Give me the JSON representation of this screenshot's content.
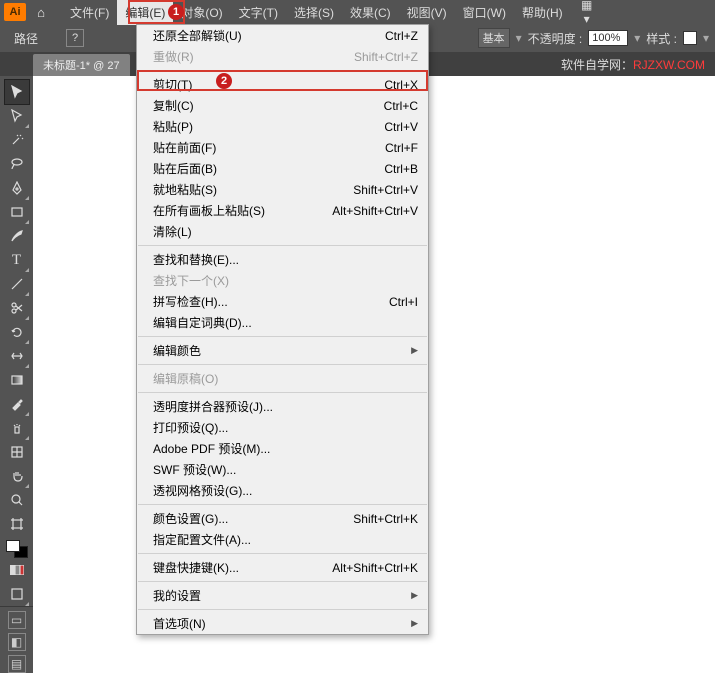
{
  "topbar": {
    "logo": "Ai",
    "menus": [
      "文件(F)",
      "编辑(E)",
      "对象(O)",
      "文字(T)",
      "选择(S)",
      "效果(C)",
      "视图(V)",
      "窗口(W)",
      "帮助(H)"
    ]
  },
  "controlbar": {
    "label": "路径",
    "basic": "基本",
    "opacity_label": "不透明度 :",
    "opacity_value": "100%",
    "style_label": "样式 :"
  },
  "tabbar": {
    "doc": "未标题-1* @ 27",
    "tutorial_lbl": "软件自学网：",
    "tutorial_url": "RJZXW.COM"
  },
  "badges": {
    "b1": "1",
    "b2": "2"
  },
  "dropdown": [
    {
      "label": "还原全部解锁(U)",
      "shortcut": "Ctrl+Z"
    },
    {
      "label": "重做(R)",
      "shortcut": "Shift+Ctrl+Z",
      "disabled": true
    },
    {
      "sep": true
    },
    {
      "label": "剪切(T)",
      "shortcut": "Ctrl+X",
      "highlight": true
    },
    {
      "label": "复制(C)",
      "shortcut": "Ctrl+C"
    },
    {
      "label": "粘贴(P)",
      "shortcut": "Ctrl+V"
    },
    {
      "label": "贴在前面(F)",
      "shortcut": "Ctrl+F"
    },
    {
      "label": "贴在后面(B)",
      "shortcut": "Ctrl+B"
    },
    {
      "label": "就地粘贴(S)",
      "shortcut": "Shift+Ctrl+V"
    },
    {
      "label": "在所有画板上粘贴(S)",
      "shortcut": "Alt+Shift+Ctrl+V"
    },
    {
      "label": "清除(L)"
    },
    {
      "sep": true
    },
    {
      "label": "查找和替换(E)..."
    },
    {
      "label": "查找下一个(X)",
      "disabled": true
    },
    {
      "label": "拼写检查(H)...",
      "shortcut": "Ctrl+I"
    },
    {
      "label": "编辑自定词典(D)..."
    },
    {
      "sep": true
    },
    {
      "label": "编辑颜色",
      "submenu": true
    },
    {
      "sep": true
    },
    {
      "label": "编辑原稿(O)",
      "disabled": true
    },
    {
      "sep": true
    },
    {
      "label": "透明度拼合器预设(J)..."
    },
    {
      "label": "打印预设(Q)..."
    },
    {
      "label": "Adobe PDF 预设(M)..."
    },
    {
      "label": "SWF 预设(W)..."
    },
    {
      "label": "透视网格预设(G)..."
    },
    {
      "sep": true
    },
    {
      "label": "颜色设置(G)...",
      "shortcut": "Shift+Ctrl+K"
    },
    {
      "label": "指定配置文件(A)..."
    },
    {
      "sep": true
    },
    {
      "label": "键盘快捷键(K)...",
      "shortcut": "Alt+Shift+Ctrl+K"
    },
    {
      "sep": true
    },
    {
      "label": "我的设置",
      "submenu": true
    },
    {
      "sep": true
    },
    {
      "label": "首选项(N)",
      "submenu": true
    }
  ]
}
